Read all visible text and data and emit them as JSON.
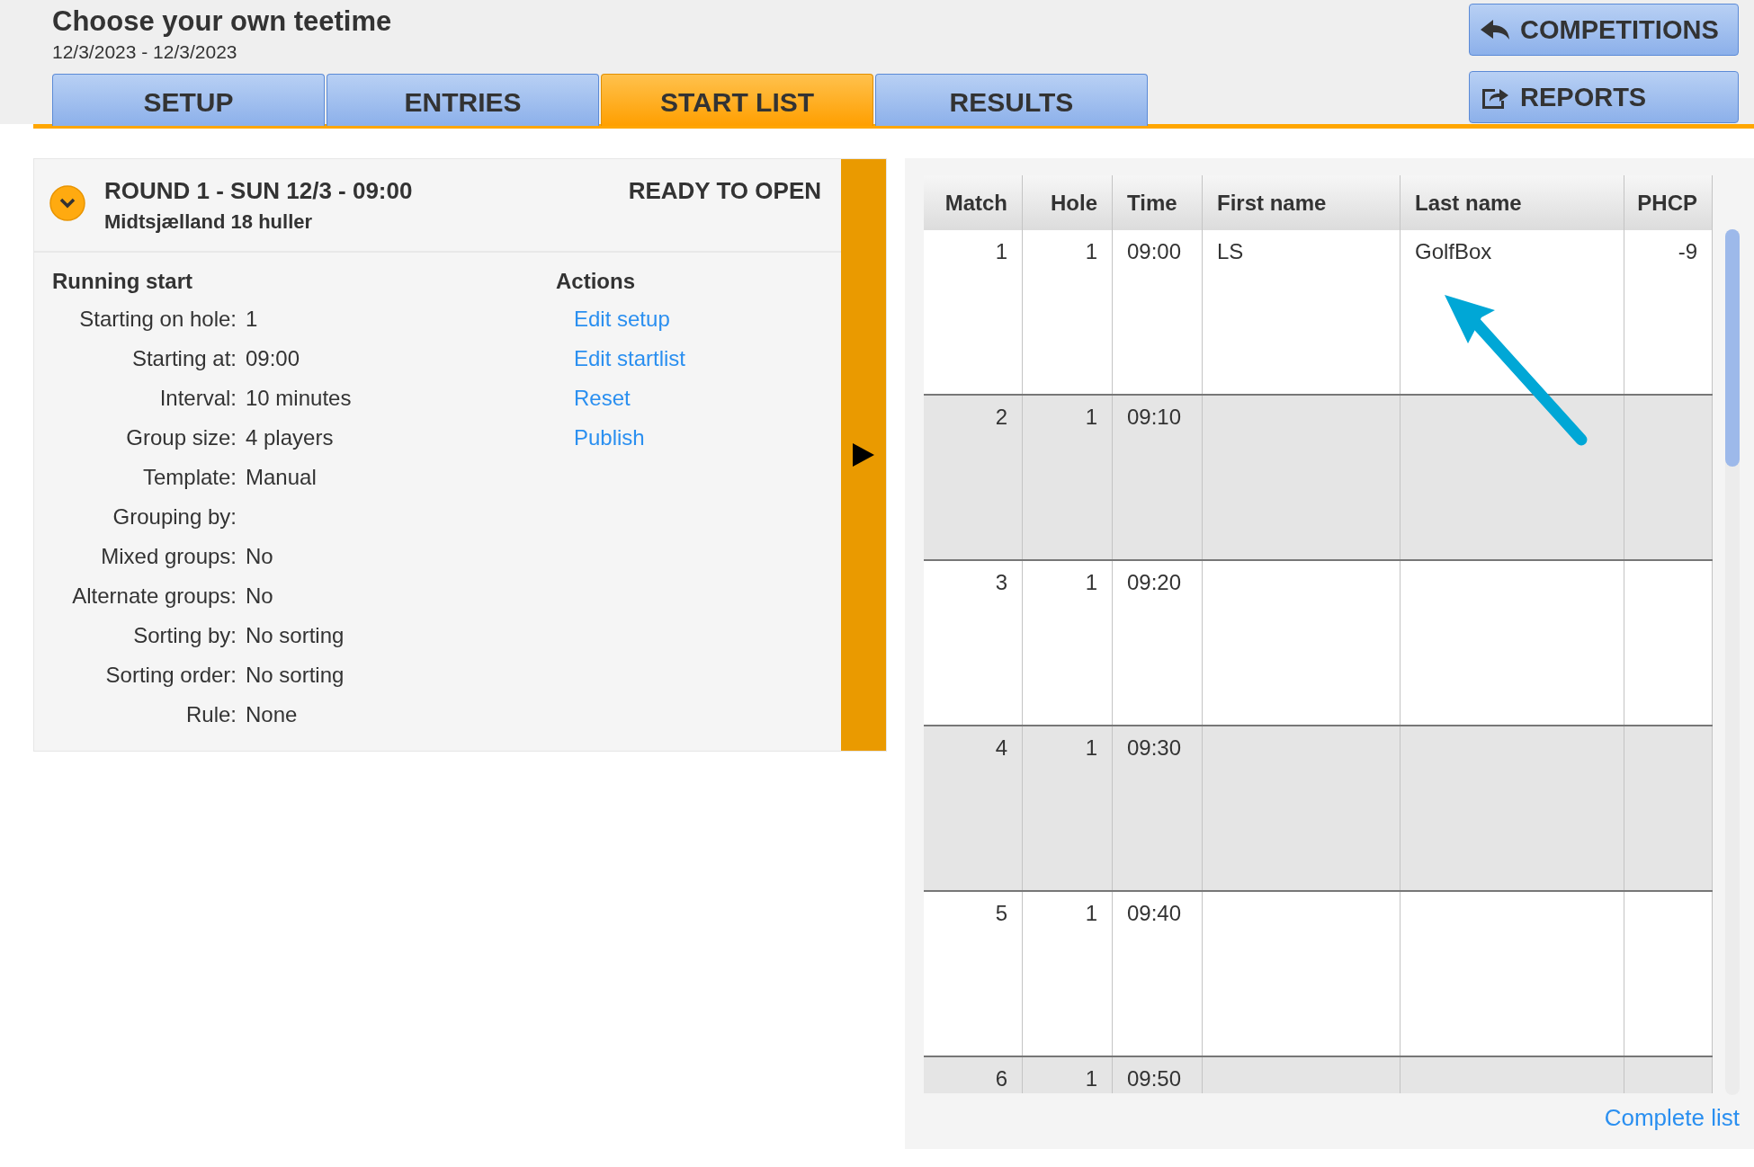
{
  "header": {
    "title": "Choose your own teetime",
    "date_range": "12/3/2023 - 12/3/2023"
  },
  "tabs": [
    {
      "label": "SETUP",
      "selected": false
    },
    {
      "label": "ENTRIES",
      "selected": false
    },
    {
      "label": "START LIST",
      "selected": true
    },
    {
      "label": "RESULTS",
      "selected": false
    }
  ],
  "nav_buttons": [
    {
      "label": "COMPETITIONS",
      "kind": "back"
    },
    {
      "label": "REPORTS",
      "kind": "export"
    }
  ],
  "round": {
    "expanded": true,
    "title": "ROUND 1 - SUN 12/3 - 09:00",
    "course": "Midtsjælland 18 huller",
    "status": "READY TO OPEN",
    "section_title": "Running start",
    "fields": [
      {
        "label": "Starting on hole:",
        "value": "1"
      },
      {
        "label": "Starting at:",
        "value": "09:00"
      },
      {
        "label": "Interval:",
        "value": "10 minutes"
      },
      {
        "label": "Group size:",
        "value": "4 players"
      },
      {
        "label": "Template:",
        "value": "Manual"
      },
      {
        "label": "Grouping by:"
      },
      {
        "label": "Mixed groups:",
        "value": "No"
      },
      {
        "label": "Alternate groups:",
        "value": "No"
      },
      {
        "label": "Sorting by:",
        "value": "No sorting"
      },
      {
        "label": "Sorting order:",
        "value": "No sorting"
      },
      {
        "label": "Rule:",
        "value": "None"
      }
    ],
    "actions_title": "Actions",
    "actions": [
      "Edit setup",
      "Edit startlist",
      "Reset",
      "Publish"
    ]
  },
  "table": {
    "columns": [
      "Match",
      "Hole",
      "Time",
      "First name",
      "Last name",
      "PHCP"
    ],
    "rows": [
      {
        "cells": [
          "1",
          "1",
          "09:00",
          "LS",
          "GolfBox",
          "-9"
        ]
      },
      {
        "cells": [
          "2",
          "1",
          "09:10"
        ]
      },
      {
        "cells": [
          "3",
          "1",
          "09:20"
        ]
      },
      {
        "cells": [
          "4",
          "1",
          "09:30"
        ]
      },
      {
        "cells": [
          "5",
          "1",
          "09:40"
        ]
      },
      {
        "cells": [
          "6",
          "1",
          "09:50"
        ]
      }
    ]
  },
  "footer_link": "Complete list"
}
